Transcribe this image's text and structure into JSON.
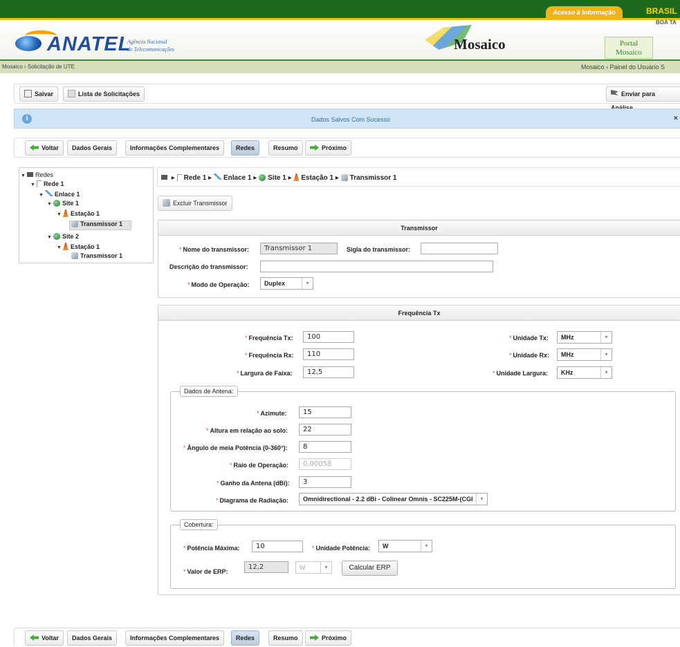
{
  "gov_bar": {
    "acesso_label": "Acesso à Informação",
    "brasil": "BRASIL",
    "greeting": "BOA TA"
  },
  "header": {
    "logo_text": "ANATEL",
    "agencia_line1": "Agência Nacional",
    "agencia_line2": "de Telecomunicações",
    "app_title": "Mosaico",
    "portal_line1": "Portal",
    "portal_line2": "Mosaico"
  },
  "breadcrumb_bar": {
    "left": "Mosaico › Solicitação de UTE",
    "right": "Mosaico › Painel do Usuário  S"
  },
  "toolbar": {
    "save": "Salvar",
    "list": "Lista de Solicitações",
    "send": "Enviar para Análise"
  },
  "message": {
    "icon": "i",
    "text": "Dados Salvos Com Sucesso",
    "close": "×"
  },
  "nav": {
    "back": "Voltar",
    "tabs": [
      "Dados Gerais",
      "Informações Complementares",
      "Redes",
      "Resumo"
    ],
    "active": "Redes",
    "next": "Próximo"
  },
  "tree": {
    "root": "Redes",
    "rede": "Rede 1",
    "enlace": "Enlace 1",
    "site1": "Site 1",
    "estacao1": "Estação 1",
    "tx1": "Transmissor 1",
    "site2": "Site 2",
    "estacao2": "Estação 1",
    "tx2": "Transmissor 1"
  },
  "path": {
    "rede": "Rede 1",
    "enlace": "Enlace 1",
    "site": "Site 1",
    "estacao": "Estação 1",
    "transmissor": "Transmissor 1"
  },
  "actions": {
    "delete_tx": "Excluir Transmissor"
  },
  "transmissor": {
    "title": "Transmissor",
    "name_label": "Nome do transmissor:",
    "name_value": "Transmissor  1",
    "sigla_label": "Sigla do transmissor:",
    "sigla_value": "",
    "desc_label": "Descrição do transmissor:",
    "desc_value": "",
    "modo_label": "Modo de Operação:",
    "modo_value": "Duplex"
  },
  "frequencia": {
    "title": "Frequência Tx",
    "tx_label": "Frequência Tx:",
    "tx_value": "100",
    "rx_label": "Frequência Rx:",
    "rx_value": "110",
    "largura_label": "Largura de Faixa:",
    "largura_value": "12,5",
    "unid_tx_label": "Unidade Tx:",
    "unid_tx_value": "MHz",
    "unid_rx_label": "Unidade Rx:",
    "unid_rx_value": "MHz",
    "unid_larg_label": "Unidade Largura:",
    "unid_larg_value": "KHz"
  },
  "antena": {
    "legend": "Dados de Antena:",
    "azimute_label": "Azimute:",
    "azimute_value": "15",
    "altura_label": "Altura em relação ao solo:",
    "altura_value": "22",
    "angulo_label": "Ângulo de meia Potência (0-360°):",
    "angulo_value": "8",
    "raio_label": "Raio de Operação:",
    "raio_value": "0,00058",
    "ganho_label": "Ganho da Antena (dBi):",
    "ganho_value": "3",
    "diagrama_label": "Diagrama de Radiação:",
    "diagrama_value": "Omnidirectional - 2.2 dBi - Colinear Omnis - SC225M-(CGI"
  },
  "cobertura": {
    "legend": "Cobertura:",
    "pot_label": "Potência Máxima:",
    "pot_value": "10",
    "unid_pot_label": "Unidade Potência:",
    "unid_pot_value": "W",
    "erp_label": "Valor de ERP:",
    "erp_value": "12,2",
    "erp_unit": "W",
    "calc_button": "Calcular ERP"
  },
  "required_mark": "*"
}
